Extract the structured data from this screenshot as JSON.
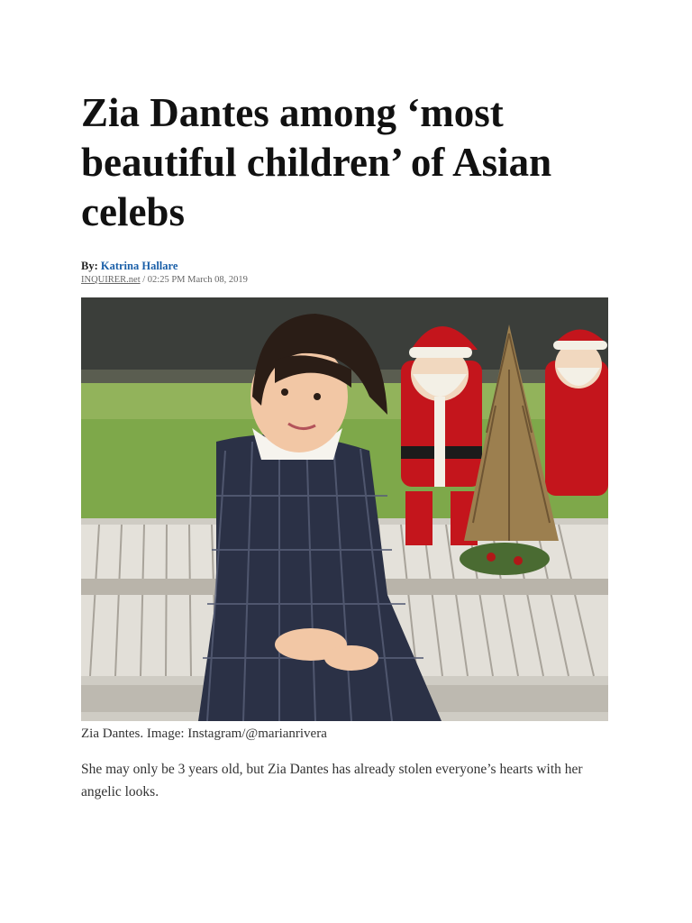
{
  "article": {
    "title": "Zia Dantes among ‘most beautiful children’ of Asian celebs",
    "byline_prefix": "By:",
    "author": "Katrina Hallare",
    "source": "INQUIRER.net",
    "separator": " / ",
    "timestamp": "02:25 PM March 08, 2019",
    "caption": "Zia Dantes. Image: Instagram/@marianrivera",
    "paragraph": "She may only be 3 years old, but Zia Dantes has already stolen everyone’s hearts with her angelic looks."
  },
  "colors": {
    "author_link": "#1a5fa8",
    "santa_red": "#c4151c",
    "grass": "#7ea84a",
    "bench": "#d9d6cf",
    "dress": "#2b3146"
  }
}
